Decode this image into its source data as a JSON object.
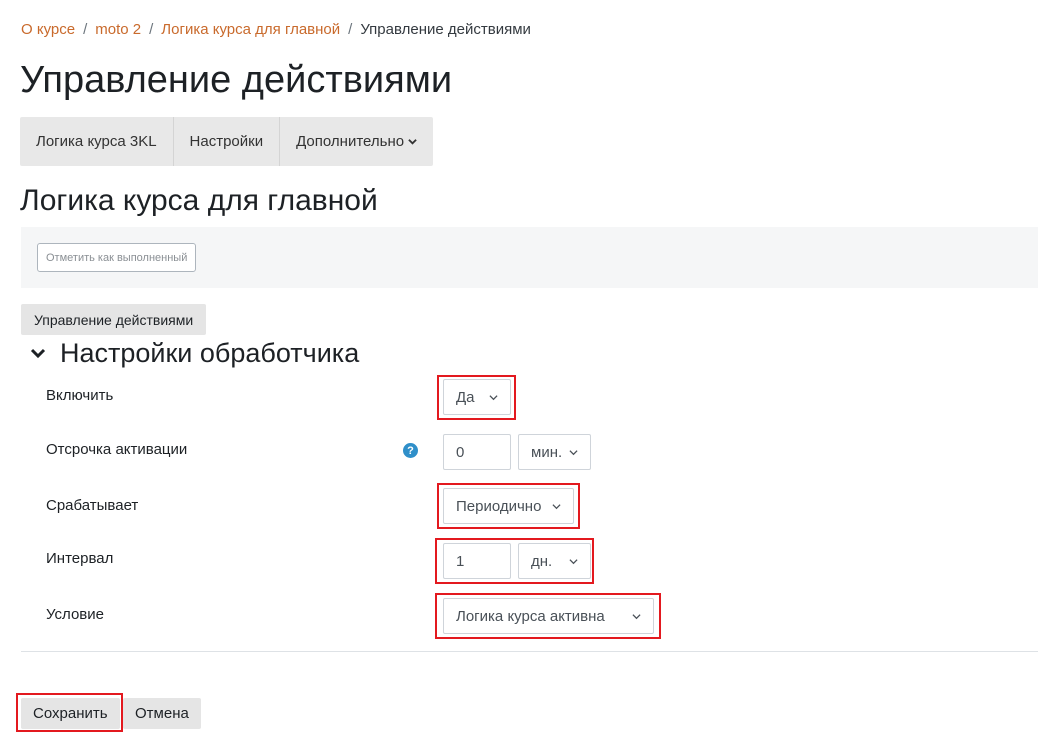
{
  "breadcrumb": {
    "items": [
      "О курсе",
      "moto 2",
      "Логика курса для главной"
    ],
    "current": "Управление действиями",
    "separator": "/"
  },
  "page_title": "Управление действиями",
  "secondary_nav": {
    "items": [
      "Логика курса 3KL",
      "Настройки",
      "Дополнительно"
    ]
  },
  "section_title": "Логика курса для главной",
  "completion": {
    "button_label": "Отметить как выполненный"
  },
  "manage_button_label": "Управление действиями",
  "fieldset": {
    "legend": "Настройки обработчика",
    "fields": {
      "enable": {
        "label": "Включить",
        "value": "Да"
      },
      "delay": {
        "label": "Отсрочка активации",
        "value": "0",
        "unit": "мин.",
        "help": "?"
      },
      "trigger": {
        "label": "Срабатывает",
        "value": "Периодично"
      },
      "interval": {
        "label": "Интервал",
        "value": "1",
        "unit": "дн."
      },
      "condition": {
        "label": "Условие",
        "value": "Логика курса активна"
      }
    }
  },
  "actions": {
    "save": "Сохранить",
    "cancel": "Отмена"
  },
  "colors": {
    "link": "#c96a2c",
    "highlight": "#e3191f",
    "help": "#2f8fc9"
  },
  "icons": [
    "chevron-down-icon",
    "question-circle-icon"
  ]
}
